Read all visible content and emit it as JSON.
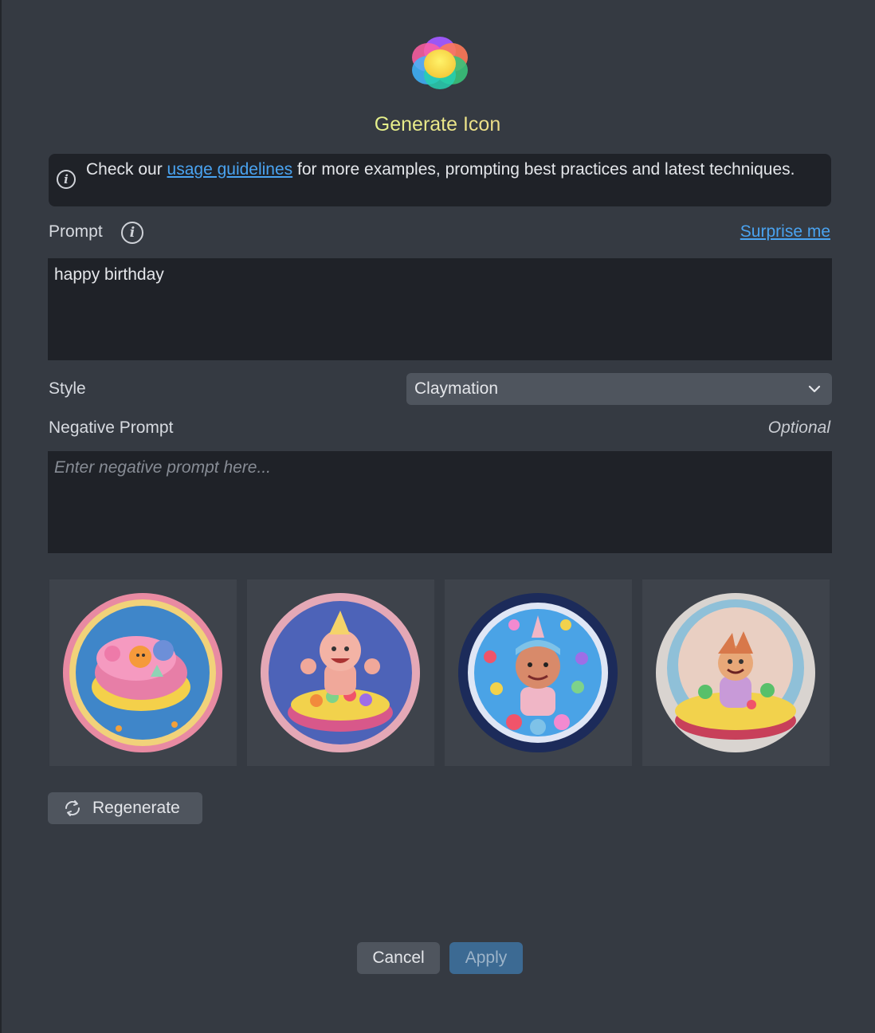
{
  "dialog": {
    "title": "Generate Icon",
    "logo_icon": "ai-assistant-logo-icon"
  },
  "info_banner": {
    "icon": "info-icon",
    "text_before": "Check our ",
    "link_text": "usage guidelines",
    "text_after": " for more examples, prompting best practices and latest techniques."
  },
  "prompt": {
    "label": "Prompt",
    "info_icon": "info-icon",
    "surprise_link": "Surprise me",
    "value": "happy birthday"
  },
  "style": {
    "label": "Style",
    "selected": "Claymation",
    "icon": "chevron-down-icon"
  },
  "negative_prompt": {
    "label": "Negative Prompt",
    "hint": "Optional",
    "placeholder": "Enter negative prompt here..."
  },
  "results": [
    {
      "subject": "birthday cake"
    },
    {
      "subject": "party character on cake"
    },
    {
      "subject": "party character in flower wreath"
    },
    {
      "subject": "jester on cake"
    }
  ],
  "regenerate": {
    "label": "Regenerate",
    "icon": "refresh-icon"
  },
  "footer": {
    "cancel_label": "Cancel",
    "apply_label": "Apply"
  },
  "colors": {
    "background": "#353a42",
    "input_bg": "#1f2228",
    "link": "#4aa3f0",
    "apply_bg": "#3c6a93"
  }
}
